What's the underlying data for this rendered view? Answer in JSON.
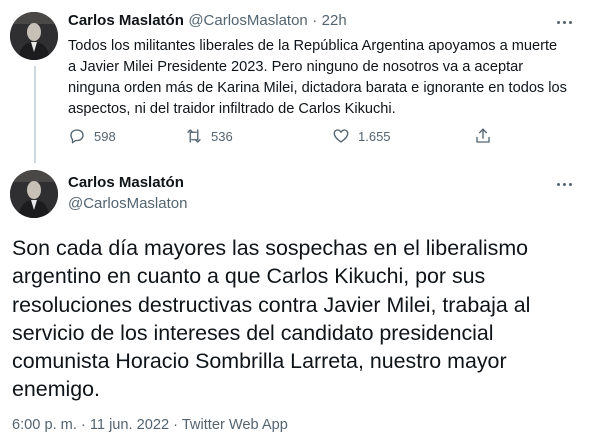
{
  "parent_tweet": {
    "author_name": "Carlos Maslatón",
    "author_handle": "@CarlosMaslaton",
    "separator": "·",
    "time_ago": "22h",
    "text": "Todos los militantes liberales de la República Argentina apoyamos a muerte a Javier Milei Presidente 2023. Pero ninguno de nosotros va a aceptar ninguna orden más de Karina Milei, dictadora barata e ignorante en todos los aspectos, ni del traidor infiltrado de Carlos Kikuchi.",
    "replies": "598",
    "retweets": "536",
    "likes": "1.655"
  },
  "main_tweet": {
    "author_name": "Carlos Maslatón",
    "author_handle": "@CarlosMaslaton",
    "text": "Son cada día mayores las sospechas en el liberalismo argentino en cuanto a que Carlos Kikuchi, por sus resoluciones destructivas contra Javier Milei, trabaja al servicio de los intereses del candidato presidencial comunista Horacio Sombrilla Larreta, nuestro mayor enemigo.",
    "timestamp": "6:00 p. m. · 11 jun. 2022 · Twitter Web App"
  },
  "icons": {
    "reply": "reply-icon",
    "retweet": "retweet-icon",
    "like": "heart-icon",
    "share": "share-icon",
    "more": "more-icon"
  },
  "colors": {
    "text": "#0f1419",
    "secondary": "#536471",
    "thread_line": "#cfd9de"
  }
}
